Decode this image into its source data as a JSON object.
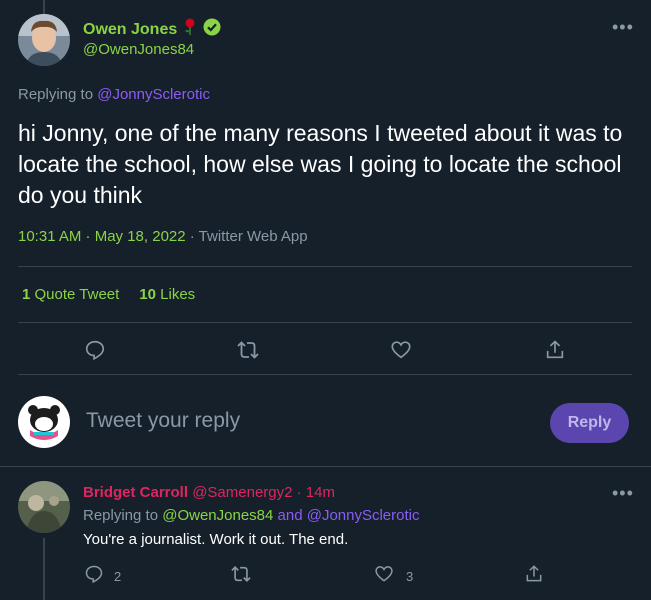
{
  "tweet": {
    "author_name": "Owen Jones",
    "author_handle": "@OwenJones84",
    "replying_label": "Replying to",
    "replying_to": "@JonnySclerotic",
    "text": "hi Jonny, one of the many reasons I tweeted about it was to locate the school, how else was I going to locate the school do you think",
    "time": "10:31 AM · May 18, 2022",
    "source": " · Twitter Web App",
    "quote_count": "1",
    "quote_label": "Quote Tweet",
    "like_count": "10",
    "like_label": "Likes"
  },
  "compose": {
    "placeholder": "Tweet your reply",
    "reply_button": "Reply"
  },
  "reply": {
    "name": "Bridget Carroll",
    "handle_time": "@Samenergy2 · 14m",
    "replying_label": "Replying to",
    "replying_first": "@OwenJones84",
    "replying_and": "and",
    "replying_second": "@JonnySclerotic",
    "text": "You're a journalist. Work it out. The end.",
    "reply_count": "2",
    "like_count": "3"
  },
  "icons": [
    "rose-icon",
    "verified-icon",
    "more-icon",
    "reply-icon",
    "retweet-icon",
    "like-icon",
    "share-icon"
  ],
  "colors": {
    "background": "#15202b",
    "accent_green": "#8bd346",
    "accent_purple": "#8b5cf6",
    "muted": "#8b98a5",
    "divider": "#38444d",
    "reply_button_bg": "#5b46b0",
    "commenter_name": "#e0245e"
  }
}
